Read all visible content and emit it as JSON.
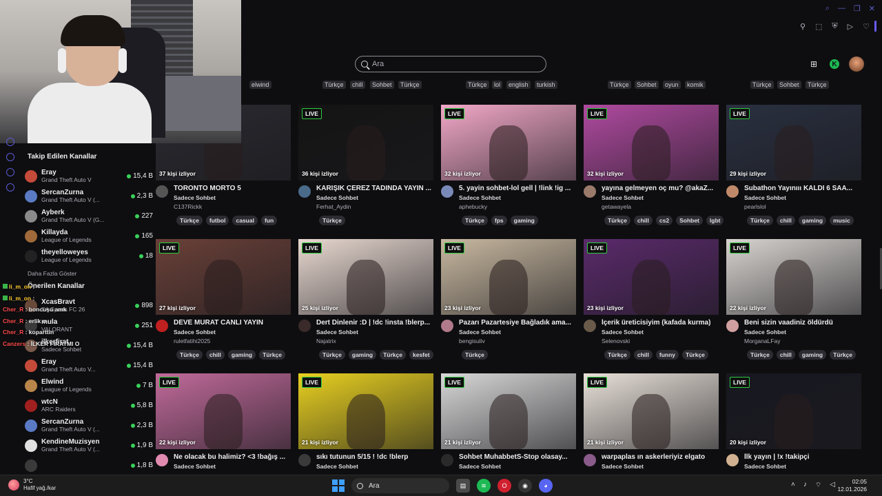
{
  "search": {
    "placeholder": "Ara"
  },
  "top_tags": [
    {
      "label": "elwind"
    },
    {
      "label": "Türkçe"
    },
    {
      "label": "chill"
    },
    {
      "label": "Sohbet"
    },
    {
      "label": "Türkçe"
    },
    {
      "label": "Türkçe"
    },
    {
      "label": "lol"
    },
    {
      "label": "english"
    },
    {
      "label": "turkish"
    },
    {
      "label": "Türkçe"
    },
    {
      "label": "Sohbet"
    },
    {
      "label": "oyun"
    },
    {
      "label": "komik"
    },
    {
      "label": "Türkçe"
    },
    {
      "label": "Sohbet"
    },
    {
      "label": "Türkçe"
    }
  ],
  "sidebar": {
    "followed_title": "Takip Edilen Kanallar",
    "followed": [
      {
        "name": "Eray",
        "game": "Grand Theft Auto V",
        "viewers": "15,4 B",
        "color": "#c44a3a"
      },
      {
        "name": "SercanZurna",
        "game": "Grand Theft Auto V (...",
        "viewers": "2,3 B",
        "color": "#5a7ac4"
      },
      {
        "name": "Ayberk",
        "game": "Grand Theft Auto V (G...",
        "viewers": "227",
        "color": "#8a8a8a"
      },
      {
        "name": "Killayda",
        "game": "League of Legends",
        "viewers": "165",
        "color": "#a06a3a"
      },
      {
        "name": "theyelloweyes",
        "game": "League of Legends",
        "viewers": "18",
        "color": "#222222"
      }
    ],
    "show_more": "Daha Fazla Göster",
    "recommended_title": "Önerilen Kanallar",
    "recommended": [
      {
        "name": "XcasBravt",
        "game": "EA Sports FC 26",
        "viewers": "898",
        "color": "#6a4a3a"
      },
      {
        "name": "mula",
        "game": "VALORANT",
        "viewers": "251",
        "color": "#3a3a3a"
      },
      {
        "name": "ilkerfirat",
        "game": "Sadece Sohbet",
        "viewers": "15,4 B",
        "color": "#7a5a4a"
      },
      {
        "name": "Eray",
        "game": "Grand Theft Auto V...",
        "viewers": "15,4 B",
        "color": "#c44a3a"
      },
      {
        "name": "Elwind",
        "game": "League of Legends",
        "viewers": "7 B",
        "color": "#b8864a"
      },
      {
        "name": "wtcN",
        "game": "ARC Raiders",
        "viewers": "5,8 B",
        "color": "#a02020"
      },
      {
        "name": "SercanZurna",
        "game": "Grand Theft Auto V (...",
        "viewers": "2,3 B",
        "color": "#5a7ac4"
      },
      {
        "name": "KendineMuzisyen",
        "game": "Grand Theft Auto V (...",
        "viewers": "1,9 B",
        "color": "#e0e0e0"
      },
      {
        "name": "",
        "game": "",
        "viewers": "1,8 B",
        "color": "#3a3a3a"
      }
    ]
  },
  "chat": [
    {
      "nick": "li_m_on",
      "text": "",
      "badge": true,
      "orange": true
    },
    {
      "nick": "li_m_on",
      "text": "",
      "badge": true,
      "orange": true
    },
    {
      "nick": "Cher_R",
      "text": "boncuşu amk",
      "badge": false,
      "orange": false
    },
    {
      "nick": "Cher_R",
      "text": "erlik o",
      "badge": false,
      "orange": false
    },
    {
      "nick": "Cher_R",
      "text": "koparttin",
      "badge": false,
      "orange": false
    },
    {
      "nick": "Canzers",
      "text": "İLKER FİRATMI O",
      "badge": false,
      "orange": false
    }
  ],
  "cards": [
    {
      "viewers": "37 kişi izliyor",
      "title": "TORONTO MORTO 5",
      "category": "Sadece Sohbet",
      "name": "C137Rickk",
      "tags": [
        "Türkçe",
        "futbol",
        "casual",
        "fun"
      ],
      "bg": "#2a2a30",
      "live": false,
      "av": "#555"
    },
    {
      "viewers": "36 kişi izliyor",
      "title": "KARIŞIK ÇEREZ TADINDA YAYIN ...",
      "category": "Sadece Sohbet",
      "name": "Ferhat_Aydin",
      "tags": [
        "Türkçe"
      ],
      "bg": "#141414",
      "live": true,
      "av": "#4a6a8a"
    },
    {
      "viewers": "32 kişi izliyor",
      "title": "5. yayin sohbet-lol gell | !link !ig ...",
      "category": "Sadece Sohbet",
      "name": "aphebucky",
      "tags": [
        "Türkçe",
        "fps",
        "gaming"
      ],
      "bg": "#f2a8c8",
      "live": true,
      "av": "#7a8ab8"
    },
    {
      "viewers": "32 kişi izliyor",
      "title": "yayına gelmeyen oç mu? @akaZ...",
      "category": "Sadece Sohbet",
      "name": "getawayela",
      "tags": [
        "Türkçe",
        "chill",
        "cs2",
        "Sohbet",
        "lgbt"
      ],
      "bg": "#b04aa0",
      "live": true,
      "av": "#9a7a6a"
    },
    {
      "viewers": "29 kişi izliyor",
      "title": "Subathon Yayınııı KALDI 6 SAA...",
      "category": "Sadece Sohbet",
      "name": "pearlslol",
      "tags": [
        "Türkçe",
        "chill",
        "gaming",
        "music"
      ],
      "bg": "#2a3040",
      "live": true,
      "av": "#c08a6a"
    },
    {
      "viewers": "27 kişi izliyor",
      "title": "DEVE MURAT CANLI YAYIN",
      "category": "Sadece Sohbet",
      "name": "ruletfatihi2025",
      "tags": [
        "Türkçe",
        "chill",
        "gaming",
        "Türkçe"
      ],
      "bg": "#6a4038",
      "live": true,
      "av": "#c02020"
    },
    {
      "viewers": "25 kişi izliyor",
      "title": "Dert Dinlenir :D | !dc !insta !blerp...",
      "category": "Sadece Sohbet",
      "name": "Najatrix",
      "tags": [
        "Türkçe",
        "gaming",
        "Türkçe",
        "kesfet"
      ],
      "bg": "#e8d8d0",
      "live": true,
      "av": "#3a2a2a"
    },
    {
      "viewers": "23 kişi izliyor",
      "title": "Pazarı Pazartesiye Bağladık ama...",
      "category": "Sadece Sohbet",
      "name": "bengisuliv",
      "tags": [
        "Türkçe"
      ],
      "bg": "#c8b8a0",
      "live": true,
      "av": "#b07a8a"
    },
    {
      "viewers": "23 kişi izliyor",
      "title": "İçerik üreticisiyim (kafada kurma)",
      "category": "Sadece Sohbet",
      "name": "Selenovski",
      "tags": [
        "Türkçe",
        "chill",
        "funny",
        "Türkçe"
      ],
      "bg": "#5a2a6a",
      "live": true,
      "av": "#6a5a4a"
    },
    {
      "viewers": "22 kişi izliyor",
      "title": "Beni sizin vaadiniz öldürdü",
      "category": "Sadece Sohbet",
      "name": "MorganaLFay",
      "tags": [
        "Türkçe",
        "chill",
        "gaming",
        "Türkçe"
      ],
      "bg": "#d8d4d0",
      "live": true,
      "av": "#d0a0a0"
    },
    {
      "viewers": "22 kişi izliyor",
      "title": "Ne olacak bu halimiz? <3 !bağış ...",
      "category": "Sadece Sohbet",
      "name": "",
      "tags": [],
      "bg": "#c06a9a",
      "live": true,
      "av": "#e08ab0"
    },
    {
      "viewers": "21 kişi izliyor",
      "title": "sıkı tutunun 5/15 ! !dc !blerp",
      "category": "Sadece Sohbet",
      "name": "",
      "tags": [],
      "bg": "#e8d020",
      "live": true,
      "av": "#3a3a3a"
    },
    {
      "viewers": "21 kişi izliyor",
      "title": "Sohbet MuhabbetS-Stop olasay...",
      "category": "Sadece Sohbet",
      "name": "",
      "tags": [],
      "bg": "#d8d8d8",
      "live": true,
      "av": "#2a2a2a"
    },
    {
      "viewers": "21 kişi izliyor",
      "title": "warpaplas ın askerleriyiz elgato",
      "category": "Sadece Sohbet",
      "name": "",
      "tags": [],
      "bg": "#e8e0d8",
      "live": true,
      "av": "#8a5a8a"
    },
    {
      "viewers": "20 kişi izliyor",
      "title": "İlk yayın | !x !takipçi",
      "category": "Sadece Sohbet",
      "name": "",
      "tags": [],
      "bg": "#181820",
      "live": true,
      "av": "#d0b090"
    }
  ],
  "live_label": "LIVE",
  "taskbar": {
    "temp": "3°C",
    "weather": "Hafif yağ./kar",
    "search": "Ara",
    "time": "02:05",
    "date": "12.01.2026"
  },
  "colors": {
    "accent": "#6a5cff",
    "live_dot": "#3ad15a",
    "bg": "#0e0e10"
  }
}
